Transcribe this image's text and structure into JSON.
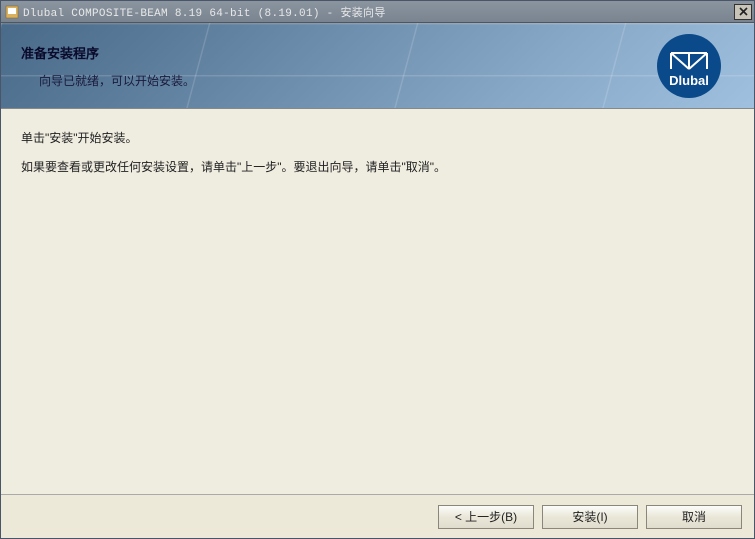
{
  "titlebar": {
    "text": "Dlubal COMPOSITE-BEAM 8.19 64-bit (8.19.01) - 安装向导"
  },
  "header": {
    "title": "准备安装程序",
    "subtitle": "向导已就绪，可以开始安装。"
  },
  "logo": {
    "brand": "Dlubal"
  },
  "content": {
    "line1": "单击\"安装\"开始安装。",
    "line2": "如果要查看或更改任何安装设置，请单击\"上一步\"。要退出向导，请单击\"取消\"。"
  },
  "buttons": {
    "back": "< 上一步(B)",
    "install": "安装(I)",
    "cancel": "取消"
  }
}
